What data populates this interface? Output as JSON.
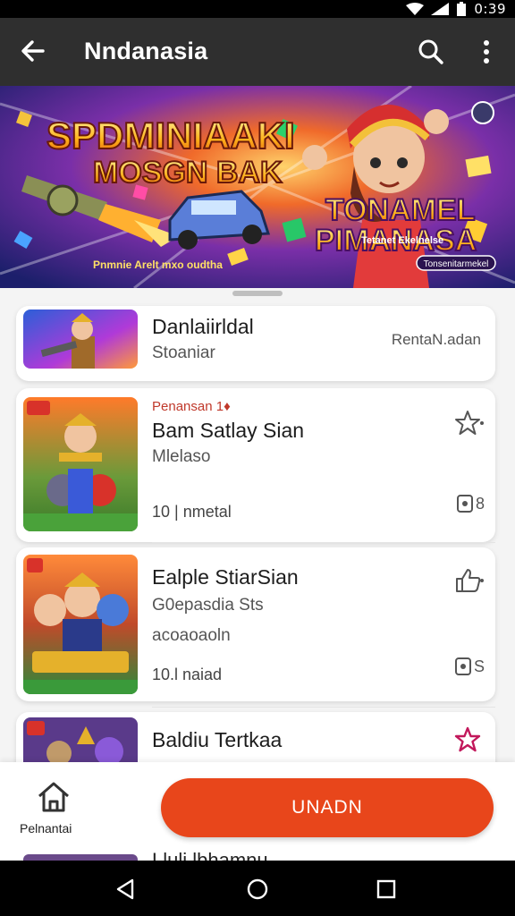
{
  "statusbar": {
    "time": "0:39",
    "icons": [
      "wifi-icon",
      "signal-icon",
      "battery-icon"
    ]
  },
  "appbar": {
    "title": "Nndanasia",
    "back_icon": "arrow-back-icon",
    "search_icon": "search-icon",
    "more_icon": "more-vert-icon"
  },
  "banner": {
    "headline_1": "SPDMINIAAKI",
    "headline_2": "MOSGN BAK",
    "caption_left": "Pnmnie Arelt mxo oudtha",
    "headline_right_1": "TONAMEL",
    "headline_right_2": "PIMANASA",
    "caption_right": "Tetanet Ekelnelse",
    "chip": "Tonsenitarmekel"
  },
  "items": [
    {
      "name": "Danlaiirldal",
      "sub": "Stoaniar",
      "right_text": "RentaN.adan"
    },
    {
      "tag": "Penansan 1♦",
      "name": "Bam Satlay Sian",
      "sub": "Mlelaso",
      "meta": "10 | nmetal",
      "right_icon": "star-outline-icon",
      "count_icon": "ticket-icon",
      "count": "8"
    },
    {
      "name": "Ealple StiarSian",
      "sub": "G0epasdia Sts",
      "sub2": "acoaoaoln",
      "meta": "10.l naiad",
      "right_icon": "thumb-up-outline-icon",
      "count_icon": "ticket-icon",
      "count": "S"
    },
    {
      "name": "Baldiu Tertkaa",
      "right_icon": "star-filled-icon"
    }
  ],
  "bottom": {
    "home_label": "Pelnantai",
    "cta_label": "UNADN"
  },
  "peek": {
    "title": "Lluli lbhamnu"
  },
  "navbar": {
    "back": "nav-back-icon",
    "home": "nav-home-icon",
    "recent": "nav-recent-icon"
  },
  "colors": {
    "appbar": "#2f2f2f",
    "accent": "#e8461b",
    "star": "#c2185b"
  }
}
